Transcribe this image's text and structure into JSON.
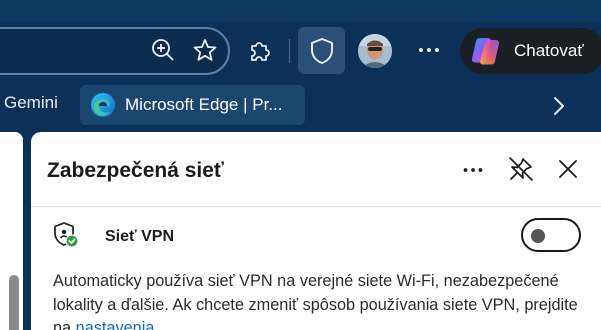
{
  "toolbar": {
    "zoom_icon": "zoom-in-icon",
    "favorites_icon": "star-icon",
    "extensions_icon": "puzzle-icon",
    "vpn_icon": "shield-icon",
    "more_icon": "more-icon",
    "chat_label": "Chatovať"
  },
  "favorites": {
    "gemini_label": "Gemini",
    "edge_item_label": "Microsoft Edge | Pr...",
    "more_icon": "chevron-right-icon"
  },
  "panel": {
    "title": "Zabezpečená sieť",
    "vpn_label": "Sieť VPN",
    "vpn_enabled": false,
    "description": "Automaticky používa sieť VPN na verejné siete Wi-Fi, nezabezpečené lokality a ďalšie. Ak chcete zmeniť spôsob používania siete VPN, prejdite na ",
    "link_text": "nastavenia",
    "link_after": "."
  },
  "colors": {
    "browser_bg": "#0b3158",
    "accent_link": "#0f6cbd",
    "shield_check": "#2e9e44"
  }
}
